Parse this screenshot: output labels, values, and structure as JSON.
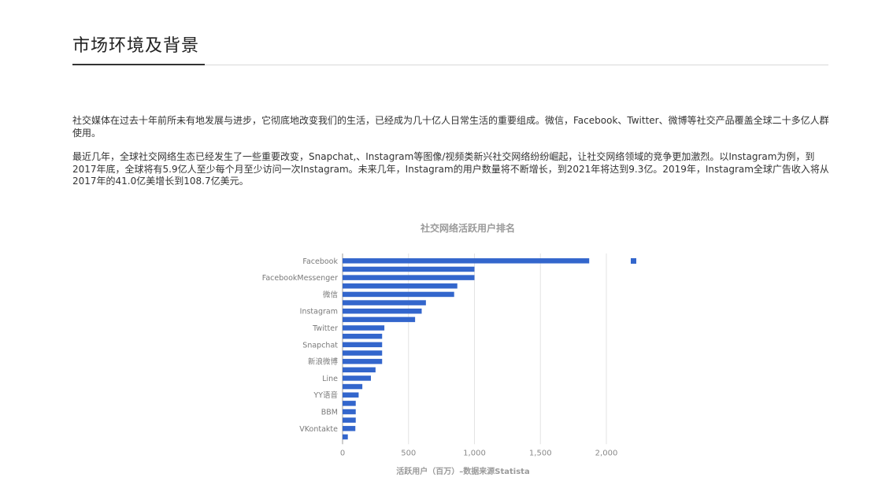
{
  "header": {
    "title": "市场环境及背景"
  },
  "content": {
    "paragraphs": [
      "社交媒体在过去十年前所未有地发展与进步，它彻底地改变我们的生活，已经成为几十亿人日常生活的重要组成。微信，Facebook、Twitter、微博等社交产品覆盖全球二十多亿人群使用。",
      "最近几年，全球社交网络生态已经发生了一些重要改变，Snapchat,、Instagram等图像/视频类新兴社交网络纷纷崛起，让社交网络领域的竞争更加激烈。以Instagram为例，到2017年底，全球将有5.9亿人至少每个月至少访问一次Instagram。未来几年，Instagram的用户数量将不断增长，到2021年将达到9.3亿。2019年，Instagram全球广告收入将从2017年的41.0亿美增长到108.7亿美元。"
    ]
  },
  "chart_data": {
    "type": "bar",
    "orientation": "horizontal",
    "title": "社交网络活跃用户排名",
    "xlabel": "活跃用户（百万）–数据来源Statista",
    "ylabel": "",
    "xlim": [
      0,
      2000
    ],
    "xticks": [
      0,
      500,
      1000,
      1500,
      2000
    ],
    "xtick_labels": [
      "0",
      "500",
      "1,000",
      "1,500",
      "2,000"
    ],
    "grid": true,
    "legend": "top-right",
    "color": "#3366cc",
    "bars": [
      {
        "label": "Facebook",
        "value": 1870
      },
      {
        "label": "",
        "value": 1000
      },
      {
        "label": "FacebookMessenger",
        "value": 1000
      },
      {
        "label": "",
        "value": 870
      },
      {
        "label": "微信",
        "value": 846
      },
      {
        "label": "",
        "value": 632
      },
      {
        "label": "Instagram",
        "value": 600
      },
      {
        "label": "",
        "value": 550
      },
      {
        "label": "Twitter",
        "value": 317
      },
      {
        "label": "",
        "value": 300
      },
      {
        "label": "Snapchat",
        "value": 300
      },
      {
        "label": "",
        "value": 300
      },
      {
        "label": "新浪微博",
        "value": 300
      },
      {
        "label": "",
        "value": 250
      },
      {
        "label": "Line",
        "value": 215
      },
      {
        "label": "",
        "value": 150
      },
      {
        "label": "YY语音",
        "value": 122
      },
      {
        "label": "",
        "value": 100
      },
      {
        "label": "BBM",
        "value": 100
      },
      {
        "label": "",
        "value": 100
      },
      {
        "label": "VKontakte",
        "value": 97
      },
      {
        "label": "",
        "value": 40
      }
    ]
  }
}
